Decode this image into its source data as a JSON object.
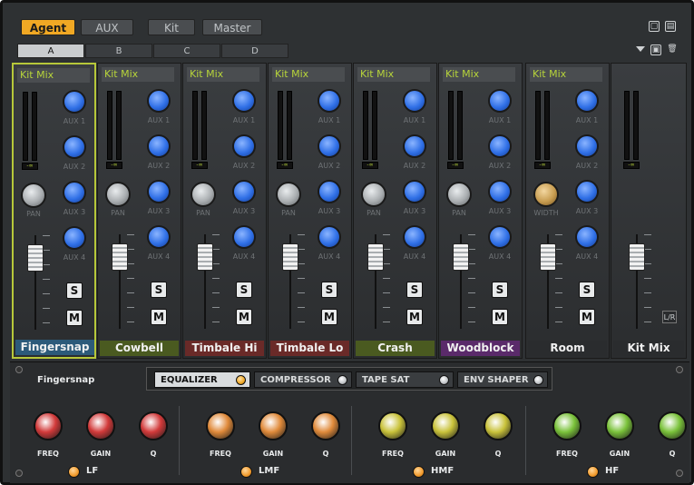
{
  "top_tabs": [
    "Agent",
    "AUX",
    "Kit",
    "Master"
  ],
  "top_tab_active": 0,
  "sub_tabs": [
    "A",
    "B",
    "C",
    "D"
  ],
  "sub_tab_active": 0,
  "icons": {
    "window_restore": "window-icon",
    "window_split": "split-icon",
    "dropdown": "dropdown-arrow-icon",
    "save": "save-icon",
    "delete": "trash-icon"
  },
  "strips": [
    {
      "header": "Kit Mix",
      "name": "Fingersnap",
      "name_color": "#2c5a7a",
      "selected": true,
      "pan_label": "PAN",
      "meter_value": "-∞",
      "aux": [
        "AUX 1",
        "AUX 2",
        "AUX 3",
        "AUX 4"
      ],
      "solo": "S",
      "mute": "M"
    },
    {
      "header": "Kit Mix",
      "name": "Cowbell",
      "name_color": "#4a5a20",
      "selected": false,
      "pan_label": "PAN",
      "meter_value": "-∞",
      "aux": [
        "AUX 1",
        "AUX 2",
        "AUX 3",
        "AUX 4"
      ],
      "solo": "S",
      "mute": "M"
    },
    {
      "header": "Kit Mix",
      "name": "Timbale Hi",
      "name_color": "#6a2a28",
      "selected": false,
      "pan_label": "PAN",
      "meter_value": "-∞",
      "aux": [
        "AUX 1",
        "AUX 2",
        "AUX 3",
        "AUX 4"
      ],
      "solo": "S",
      "mute": "M"
    },
    {
      "header": "Kit Mix",
      "name": "Timbale Lo",
      "name_color": "#6a2a28",
      "selected": false,
      "pan_label": "PAN",
      "meter_value": "-∞",
      "aux": [
        "AUX 1",
        "AUX 2",
        "AUX 3",
        "AUX 4"
      ],
      "solo": "S",
      "mute": "M"
    },
    {
      "header": "Kit Mix",
      "name": "Crash",
      "name_color": "#4a5a20",
      "selected": false,
      "pan_label": "PAN",
      "meter_value": "-∞",
      "aux": [
        "AUX 1",
        "AUX 2",
        "AUX 3",
        "AUX 4"
      ],
      "solo": "S",
      "mute": "M"
    },
    {
      "header": "Kit Mix",
      "name": "Woodblock",
      "name_color": "#5a2a6a",
      "selected": false,
      "pan_label": "PAN",
      "meter_value": "-∞",
      "aux": [
        "AUX 1",
        "AUX 2",
        "AUX 3",
        "AUX 4"
      ],
      "solo": "S",
      "mute": "M"
    },
    {
      "header": "Kit Mix",
      "name": "Room",
      "name_color": "#2a2c2e",
      "selected": false,
      "pan_label": "WIDTH",
      "meter_value": "-∞",
      "aux": [
        "AUX 1",
        "AUX 2",
        "AUX 3",
        "AUX 4"
      ],
      "solo": "S",
      "mute": "M"
    }
  ],
  "master": {
    "name": "Kit Mix",
    "meter_value": "-∞",
    "lr_label": "L/R"
  },
  "bottom": {
    "channel_title": "Fingersnap",
    "fx_tabs": [
      {
        "label": "EQUALIZER",
        "active": true
      },
      {
        "label": "COMPRESSOR",
        "active": false
      },
      {
        "label": "TAPE SAT",
        "active": false
      },
      {
        "label": "ENV SHAPER",
        "active": false
      }
    ],
    "bands": [
      {
        "label": "LF",
        "color": "#d23a3a",
        "knobs": [
          "FREQ",
          "GAIN",
          "Q"
        ]
      },
      {
        "label": "LMF",
        "color": "#e08a3a",
        "knobs": [
          "FREQ",
          "GAIN",
          "Q"
        ]
      },
      {
        "label": "HMF",
        "color": "#c9c23a",
        "knobs": [
          "FREQ",
          "GAIN",
          "Q"
        ]
      },
      {
        "label": "HF",
        "color": "#7ac23a",
        "knobs": [
          "FREQ",
          "GAIN",
          "Q"
        ]
      }
    ]
  }
}
